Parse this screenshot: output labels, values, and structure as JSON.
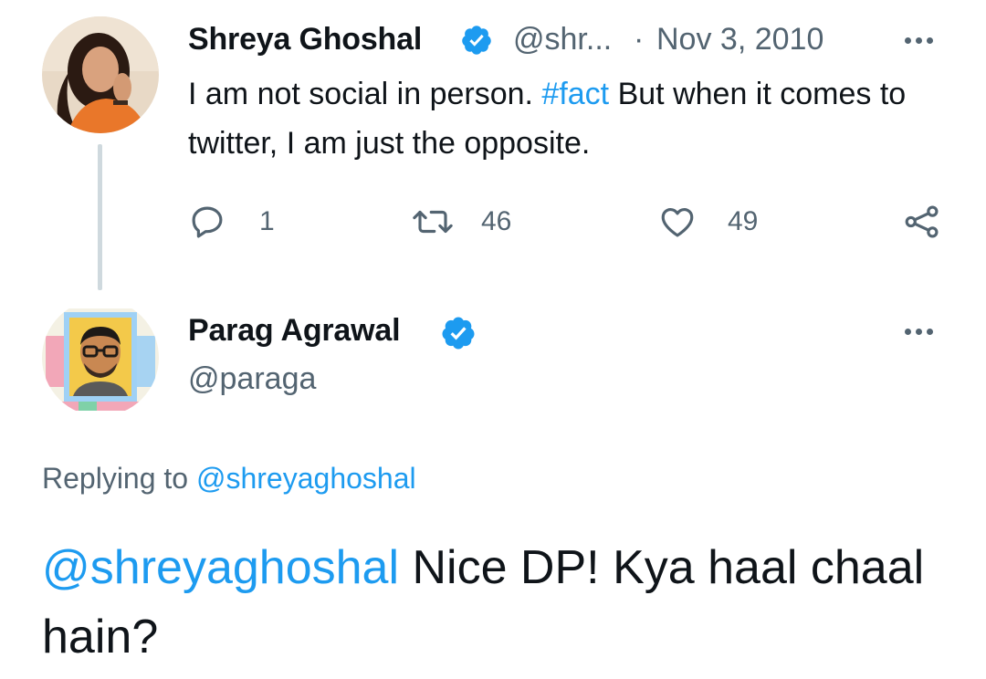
{
  "tweet": {
    "author_name": "Shreya Ghoshal",
    "author_handle": "@shr...",
    "separator": "·",
    "date": "Nov 3, 2010",
    "text_part1": "I am not social in person. ",
    "hashtag": "#fact",
    "text_part2": "  But when it comes to twitter, I am just the opposite.",
    "reply_count": "1",
    "retweet_count": "46",
    "like_count": "49",
    "verified": true
  },
  "reply": {
    "author_name": "Parag Agrawal",
    "author_handle": "@paraga",
    "verified": true,
    "replying_to_label": "Replying to ",
    "replying_to_handle": "@shreyaghoshal",
    "mention": "@shreyaghoshal",
    "text": " Nice DP! Kya haal chaal hain?"
  },
  "icons": {
    "more": "more-horizontal-icon",
    "reply": "reply-icon",
    "retweet": "retweet-icon",
    "like": "heart-icon",
    "share": "share-icon",
    "verified": "verified-badge-icon"
  },
  "colors": {
    "link": "#1d9bf0",
    "muted": "#536471",
    "text": "#0f1419",
    "thread_line": "#cfd9de"
  }
}
